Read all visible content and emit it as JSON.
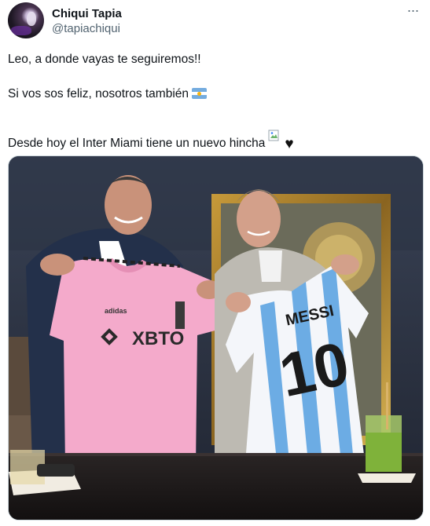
{
  "author": {
    "name": "Chiqui Tapia",
    "handle": "@tapiachiqui"
  },
  "more_icon": "more-dots-icon",
  "tweet": {
    "line1": "Leo, a donde vayas te seguiremos!!",
    "line2": "Si vos sos feliz, nosotros también",
    "line3": "Desde hoy el Inter Miami tiene un nuevo hincha",
    "emoji_flag": "argentina-flag-icon",
    "emoji_heart": "black-heart-icon",
    "heart_glyph": "♥"
  },
  "photo": {
    "pink_shirt": {
      "brand": "adidas",
      "sponsor": "XBTO"
    },
    "white_shirt": {
      "name": "MESSI",
      "number": "10"
    }
  },
  "colors": {
    "text": "#0f1419",
    "muted": "#536471",
    "pink": "#f4aacb",
    "sky": "#6cace4"
  }
}
